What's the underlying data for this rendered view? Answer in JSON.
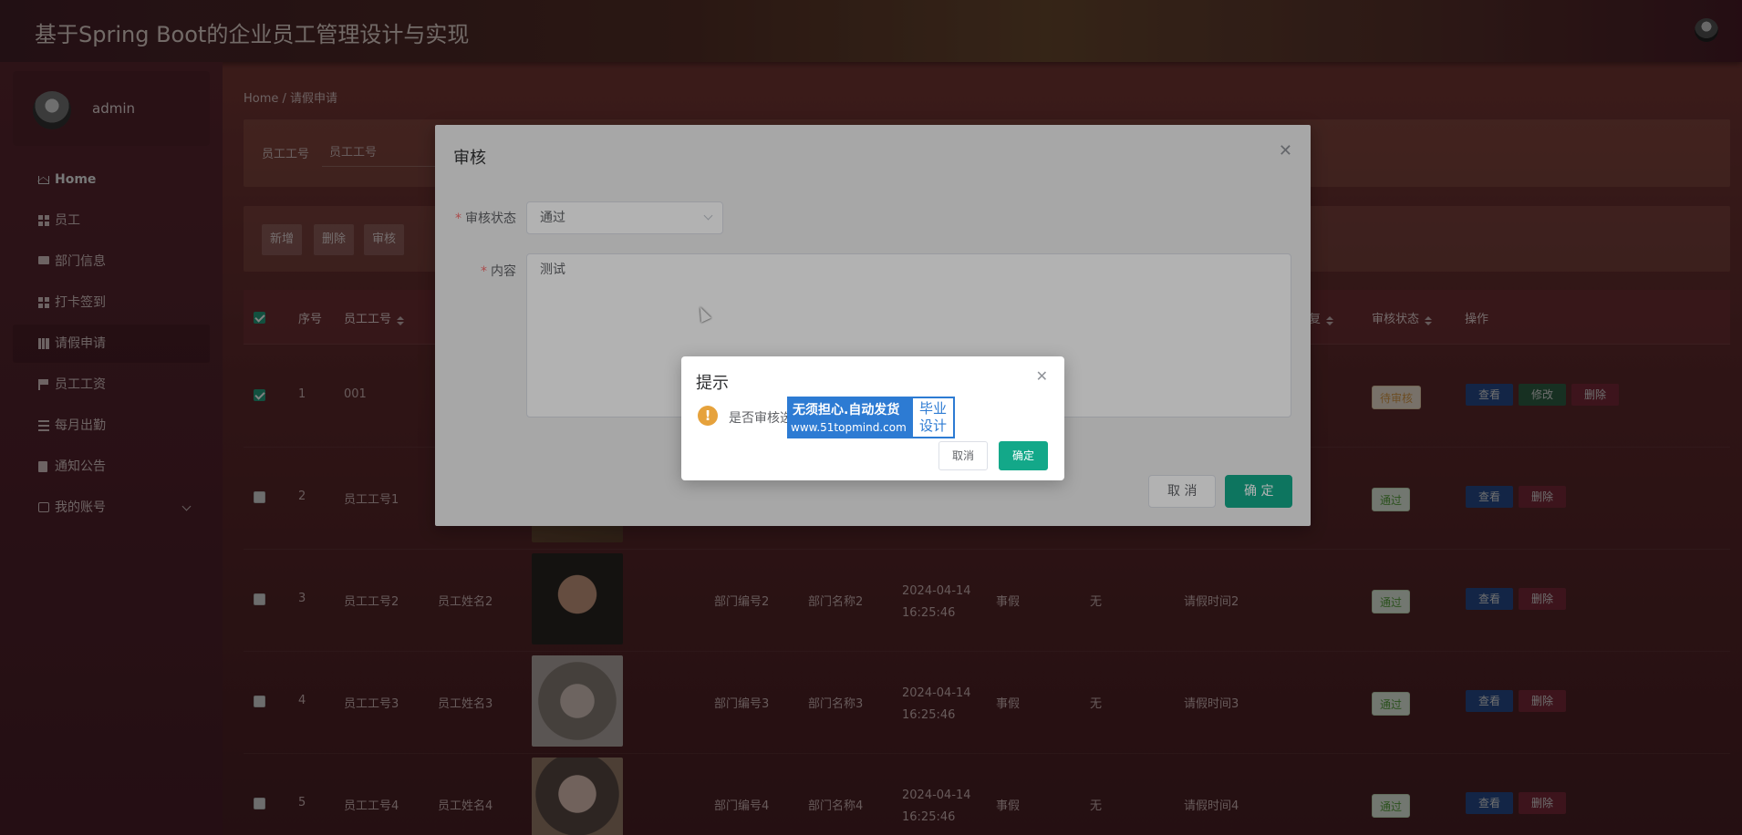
{
  "app": {
    "title": "基于Spring Boot的企业员工管理设计与实现"
  },
  "user": {
    "name": "admin"
  },
  "sidebar": {
    "items": [
      {
        "label": "Home",
        "icon": "home-icon"
      },
      {
        "label": "员工",
        "icon": "grid-icon"
      },
      {
        "label": "部门信息",
        "icon": "chat-icon"
      },
      {
        "label": "打卡签到",
        "icon": "grid-icon"
      },
      {
        "label": "请假申请",
        "icon": "chart-icon",
        "active": true
      },
      {
        "label": "员工工资",
        "icon": "flag-icon"
      },
      {
        "label": "每月出勤",
        "icon": "sliders-icon"
      },
      {
        "label": "通知公告",
        "icon": "clipboard-icon"
      },
      {
        "label": "我的账号",
        "icon": "card-icon"
      }
    ]
  },
  "breadcrumb": "Home / 请假申请",
  "search": {
    "label": "员工工号",
    "placeholder": "员工工号"
  },
  "actions": {
    "add": "新增",
    "delete": "删除",
    "review": "审核"
  },
  "table": {
    "headers": {
      "index": "序号",
      "emp_no": "员工工号",
      "reply": "回复",
      "review_status": "审核状态",
      "ops": "操作"
    },
    "rows": [
      {
        "idx": "1",
        "emp_no": "001",
        "emp_name": "",
        "dept_no": "",
        "dept_name": "",
        "time": "",
        "time2": "",
        "type": "",
        "remark": "",
        "leave_time": "",
        "status": "待审核",
        "checked": true
      },
      {
        "idx": "2",
        "emp_no": "员工工号1",
        "emp_name": "",
        "dept_no": "",
        "dept_name": "",
        "time": "",
        "time2": "",
        "type": "",
        "remark": "",
        "leave_time": "",
        "status": "通过",
        "checked": false
      },
      {
        "idx": "3",
        "emp_no": "员工工号2",
        "emp_name": "员工姓名2",
        "dept_no": "部门编号2",
        "dept_name": "部门名称2",
        "time": "2024-04-14",
        "time2": "16:25:46",
        "type": "事假",
        "remark": "无",
        "leave_time": "请假时间2",
        "status": "通过",
        "checked": false
      },
      {
        "idx": "4",
        "emp_no": "员工工号3",
        "emp_name": "员工姓名3",
        "dept_no": "部门编号3",
        "dept_name": "部门名称3",
        "time": "2024-04-14",
        "time2": "16:25:46",
        "type": "事假",
        "remark": "无",
        "leave_time": "请假时间3",
        "status": "通过",
        "checked": false
      },
      {
        "idx": "5",
        "emp_no": "员工工号4",
        "emp_name": "员工姓名4",
        "dept_no": "部门编号4",
        "dept_name": "部门名称4",
        "time": "2024-04-14",
        "time2": "16:25:46",
        "type": "事假",
        "remark": "无",
        "leave_time": "请假时间4",
        "status": "通过",
        "checked": false
      }
    ],
    "buttons": {
      "view": "查看",
      "edit": "修改",
      "delete": "删除"
    }
  },
  "review_dialog": {
    "title": "审核",
    "status_label": "审核状态",
    "status_value": "通过",
    "content_label": "内容",
    "content_value": "测试",
    "cancel": "取 消",
    "confirm": "确 定"
  },
  "confirm_box": {
    "title": "提示",
    "message": "是否审核选",
    "watermark_line1": "无须担心.自动发货",
    "watermark_line2": "www.51topmind.com",
    "watermark_badge": "毕业 设计",
    "cancel": "取消",
    "confirm": "确定"
  },
  "colors": {
    "primary": "#13a889",
    "warning": "#e6a23c",
    "pass_tag": "#59a33c",
    "pending_tag": "#d89a49"
  }
}
